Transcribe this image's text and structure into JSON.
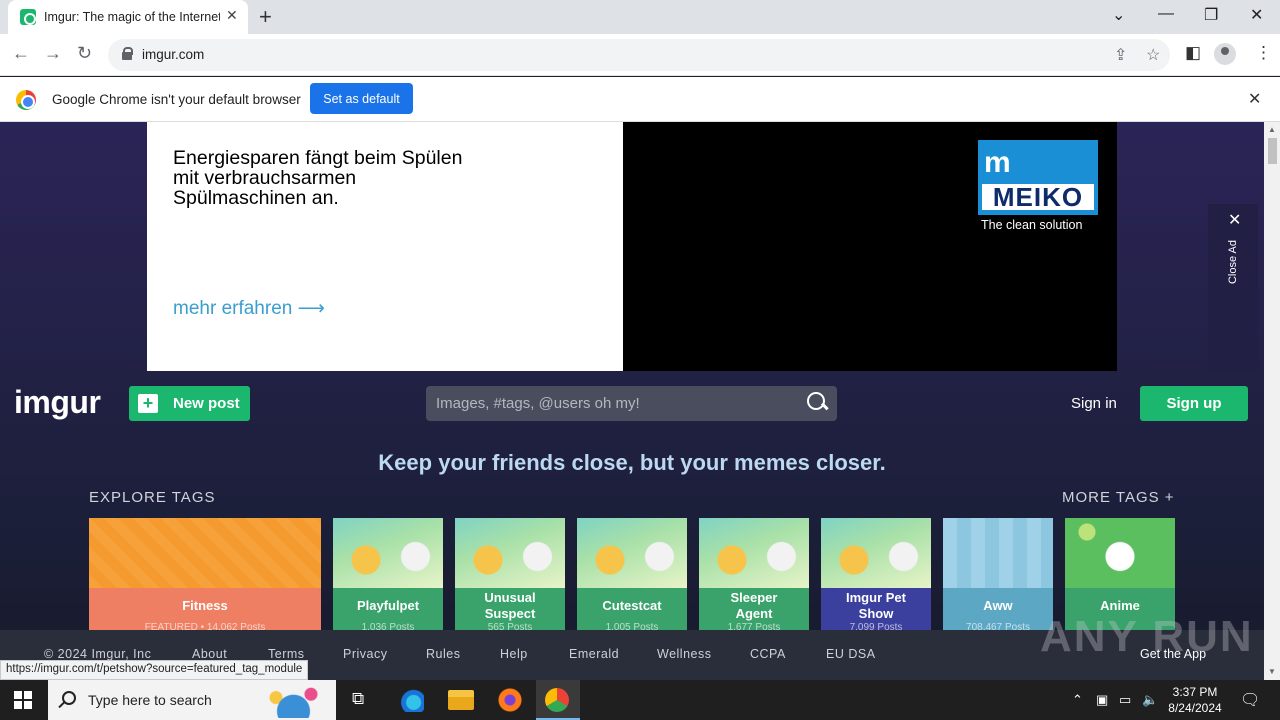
{
  "browser": {
    "tab_title": "Imgur: The magic of the Internet",
    "url": "imgur.com",
    "infobar_text": "Google Chrome isn't your default browser",
    "default_button": "Set as default",
    "status_url": "https://imgur.com/t/petshow?source=featured_tag_module"
  },
  "ad": {
    "copy_line1": "Energiesparen fängt beim Spülen",
    "copy_line2": "mit verbrauchsarmen",
    "copy_line3": "Spülmaschinen an.",
    "link": "mehr erfahren ⟶",
    "brand_mark": "m",
    "brand": "MEIKO",
    "tagline": "The clean solution",
    "close_label": "Close Ad"
  },
  "header": {
    "logo": "imgur",
    "new_post": "New post",
    "search_placeholder": "Images, #tags, @users oh my!",
    "sign_in": "Sign in",
    "sign_up": "Sign up"
  },
  "main": {
    "tagline": "Keep your friends close, but your memes closer.",
    "explore_tags": "EXPLORE TAGS",
    "more_tags": "MORE TAGS +",
    "tags": [
      {
        "name": "Fitness",
        "posts": "FEATURED • 14,062 Posts",
        "color": "#ef7f63"
      },
      {
        "name": "Playfulpet",
        "posts": "1,036 Posts",
        "color": "#3aa36b"
      },
      {
        "name": "Unusual Suspect",
        "posts": "565 Posts",
        "color": "#3aa36b"
      },
      {
        "name": "Cutestcat",
        "posts": "1,005 Posts",
        "color": "#3aa36b"
      },
      {
        "name": "Sleeper Agent",
        "posts": "1,677 Posts",
        "color": "#3aa36b"
      },
      {
        "name": "Imgur Pet Show",
        "posts": "7,099 Posts",
        "color": "#3b3f9e"
      },
      {
        "name": "Aww",
        "posts": "708,467 Posts",
        "color": "#5ba7c4"
      },
      {
        "name": "Anime",
        "posts": "",
        "color": "#3aa36b"
      }
    ]
  },
  "footer": {
    "copyright": "© 2024 Imgur, Inc",
    "links": [
      "About",
      "Terms",
      "Privacy",
      "Rules",
      "Help",
      "Emerald",
      "Wellness",
      "CCPA",
      "EU DSA"
    ],
    "get_app": "Get the App"
  },
  "watermark": "ANY RUN",
  "taskbar": {
    "search_text": "Type here to search",
    "time": "3:37 PM",
    "date": "8/24/2024"
  },
  "colors": {
    "imgur_green": "#1bb76e",
    "chrome_blue": "#1a73e8",
    "page_bg": "#27224f"
  }
}
